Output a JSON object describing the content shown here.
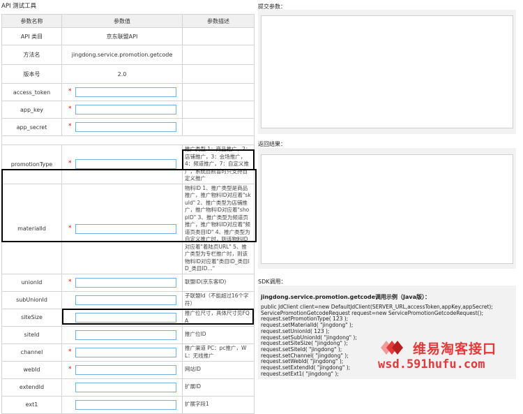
{
  "page_title": "API 测试工具",
  "table": {
    "headers": {
      "name": "参数名称",
      "value": "参数值",
      "desc": "参数描述"
    },
    "info_rows": [
      {
        "name": "API 类目",
        "value": "京东联盟API",
        "desc": ""
      },
      {
        "name": "方法名",
        "value": "jingdong.service.promotion.getcode",
        "desc": ""
      },
      {
        "name": "版本号",
        "value": "2.0",
        "desc": ""
      }
    ],
    "auth_fields": [
      {
        "name": "access_token",
        "required": "*",
        "value": ""
      },
      {
        "name": "app_key",
        "required": "*",
        "value": ""
      },
      {
        "name": "app_secret",
        "required": "*",
        "value": ""
      }
    ],
    "params": [
      {
        "name": "promotionType",
        "required": "*",
        "value": "",
        "desc": "推广类型 1：商品推广，2：店铺推广，3：会场推广，4：频道推广，7：自定义推广，系统目前暂时只支持自定义推广"
      },
      {
        "name": "materialId",
        "required": "*",
        "value": "",
        "desc": "物料ID 1、推广类型是商品推广，推广物料ID对应着\"skuId\" 2、推广类型为店铺推广，推广物料ID对应着\"shopID\" 3、推广类型为频道页推广，推广物料ID对应着\"频道页类目ID\" 4、推广类型为自定义推广时，则该物料ID对应着\"着陆页URL\" 5、推广类型为专栏推广时，则该物料ID对应着\"类目ID_类目ID_类目ID...\""
      },
      {
        "name": "unionId",
        "required": "*",
        "value": "",
        "desc": "联盟ID(京东客ID)"
      },
      {
        "name": "subUnionId",
        "required": "",
        "value": "",
        "desc": "子联盟Id（不能超过16个字符）"
      },
      {
        "name": "siteSize",
        "required": "",
        "value": "",
        "desc": "推广位尺寸，具体尺寸见FQA"
      },
      {
        "name": "siteId",
        "required": "",
        "value": "",
        "desc": "推广位ID"
      },
      {
        "name": "channel",
        "required": "*",
        "value": "",
        "desc": "推广渠道 PC：pc推广，WL：无线推广"
      },
      {
        "name": "webId",
        "required": "*",
        "value": "",
        "desc": "网站ID"
      },
      {
        "name": "extendId",
        "required": "",
        "value": "",
        "desc": "扩展ID"
      },
      {
        "name": "ext1",
        "required": "",
        "value": "",
        "desc": "扩展字段1"
      }
    ]
  },
  "right": {
    "submit_label": "提交参数：",
    "result_label": "返回结果：",
    "sdk_label": "SDK调用：",
    "sdk_title": "jingdong.service.promotion.getcode调用示例（Java版）：",
    "sdk_code": [
      "public JdClient client=new DefaultJdClient(SERVER_URL,accessToken,appKey,appSecret);",
      "ServicePromotionGetcodeRequest request=new ServicePromotionGetcodeRequest();",
      "request.setPromotionType( 123 );",
      "request.setMaterialId( \"jingdong\" );",
      "request.setUnionId( 123 );",
      "request.setSubUnionId( \"jingdong\" );",
      "request.setSiteSize( \"jingdong\" );",
      "request.setSiteId( \"jingdong\" );",
      "request.setChannel( \"jingdong\" );",
      "request.setWebId( \"jingdong\" );",
      "request.setExtendId( \"jingdong\" );",
      "request.setExt1( \"jingdong\" );"
    ]
  },
  "watermark": {
    "name": "维易淘客接口",
    "url": "wsd.591hufu.com"
  },
  "colors": {
    "required_star": "#e00000",
    "input_border": "#6fb1e4",
    "watermark": "#e23a3a"
  }
}
